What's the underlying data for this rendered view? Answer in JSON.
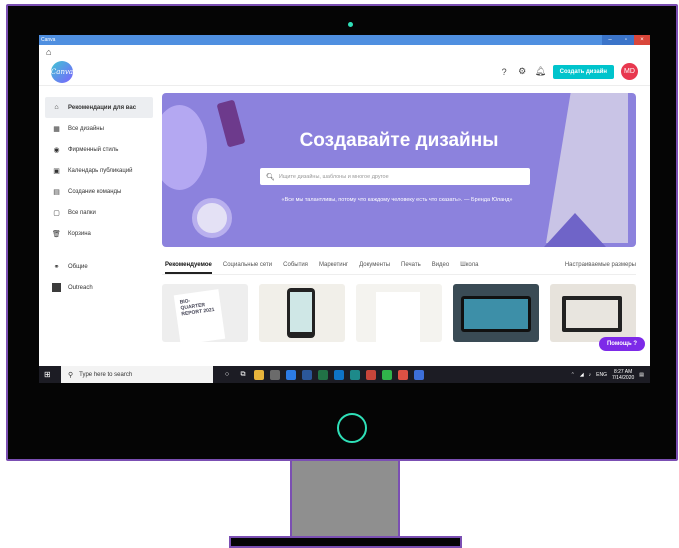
{
  "window": {
    "title": "Canva",
    "minimize": "–",
    "maximize": "▫",
    "close": "×"
  },
  "nav": {
    "home_icon": "⌂"
  },
  "topbar": {
    "logo": "Canva",
    "help_icon": "?",
    "settings_icon": "⚙",
    "notifications_icon": "♫",
    "create_button": "Создать дизайн",
    "avatar": "MD"
  },
  "sidebar": {
    "items": [
      {
        "label": "Рекомендации для вас",
        "icon": "⌂",
        "active": true
      },
      {
        "label": "Все дизайны",
        "icon": "▦"
      },
      {
        "label": "Фирменный стиль",
        "icon": "◉"
      },
      {
        "label": "Календарь публикаций",
        "icon": "▣"
      },
      {
        "label": "Создание команды",
        "icon": "▤"
      },
      {
        "label": "Все папки",
        "icon": "▢"
      },
      {
        "label": "Корзина",
        "icon": "🗑"
      }
    ],
    "groups": [
      {
        "label": "Общие",
        "icon": "⚭"
      },
      {
        "label": "Outreach",
        "icon": "■"
      }
    ]
  },
  "hero": {
    "title": "Создавайте дизайны",
    "search_placeholder": "Ищите дизайны, шаблоны и многое другое",
    "quote": "«Все мы талантливы, потому что каждому человеку есть что сказать». — Бренда Юланд»"
  },
  "tabs": {
    "items": [
      "Рекомендуемое",
      "Социальные сети",
      "События",
      "Маркетинг",
      "Документы",
      "Печать",
      "Видео",
      "Школа"
    ],
    "active": "Рекомендуемое",
    "custom": "Настраиваемые размеры"
  },
  "thumbs": {
    "first_text": "BIO-QUARTER REPORT 2021"
  },
  "help_button": "Помощь ?",
  "taskbar": {
    "search_placeholder": "Type here to search",
    "time": "8:27 AM",
    "date": "7/14/2020",
    "lang": "ENG"
  }
}
